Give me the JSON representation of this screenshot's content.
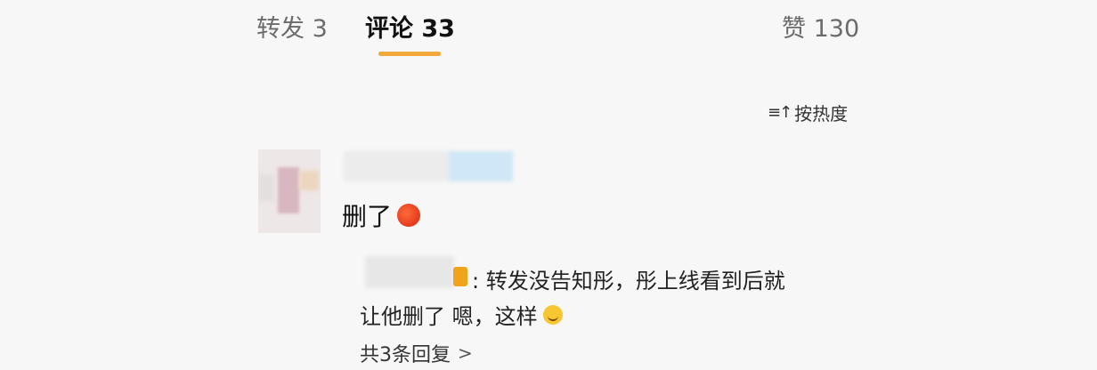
{
  "tabs": {
    "forward": "转发 3",
    "comment": "评论 33",
    "like": "赞 130"
  },
  "colors": {
    "accent": "#f2a93b",
    "vip": "#f0a41c"
  },
  "sort": {
    "icon": "sort-icon",
    "label": "按热度"
  },
  "comment": {
    "text": "删了",
    "emoji": "red-face-emoji"
  },
  "reply": {
    "line1": ": 转发没告知彤，彤上线看到后就",
    "line2": "让他删了  嗯，这样",
    "emoji": "smile-emoji"
  },
  "replies": {
    "count_label": "共3条回复",
    "chevron": ">"
  }
}
